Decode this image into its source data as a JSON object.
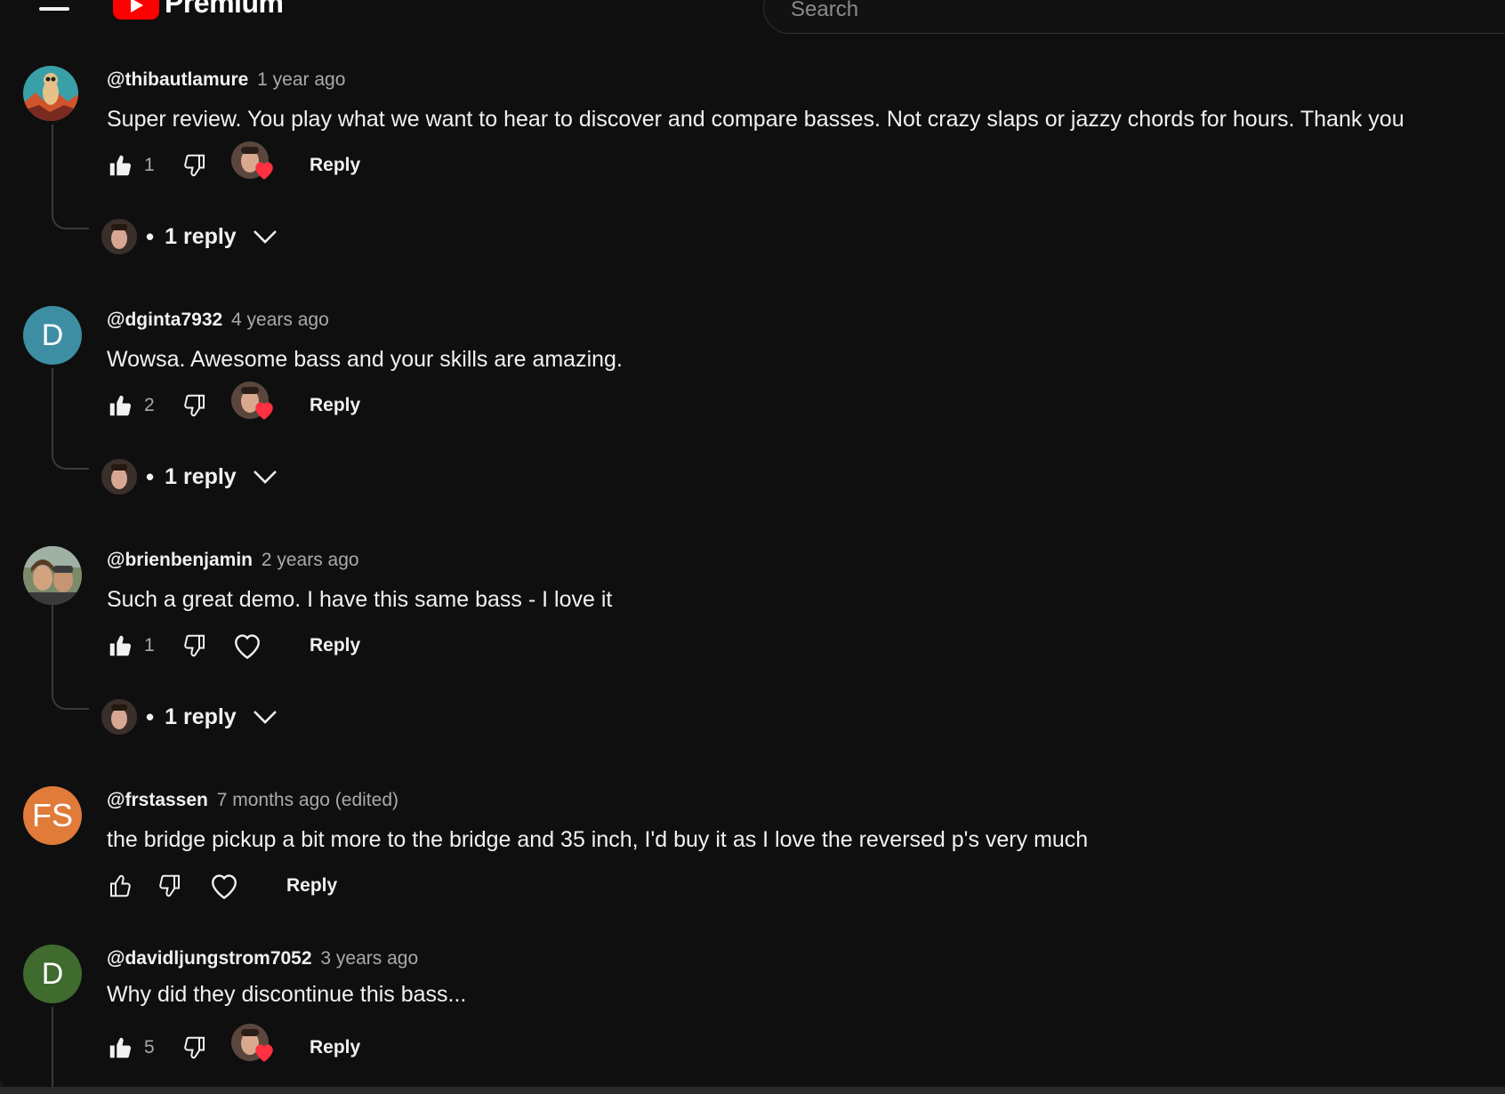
{
  "header": {
    "menu_icon": "hamburger-menu-icon",
    "logo_text": "Premium",
    "search_placeholder": "Search"
  },
  "comments": [
    {
      "handle": "@thibautlamure",
      "time": "1 year ago",
      "text": "Super review. You play what we want to hear to discover and compare basses. Not crazy slaps or jazzy chords for hours. Thank you",
      "likes": "1",
      "hearted_by_creator": true,
      "replies_label": "1 reply",
      "reply_label": "Reply",
      "avatar_color": "#c8884a"
    },
    {
      "handle": "@dginta7932",
      "time": "4 years ago",
      "text": "Wowsa.  Awesome bass and your skills are amazing.",
      "likes": "2",
      "hearted_by_creator": true,
      "replies_label": "1 reply",
      "reply_label": "Reply",
      "avatar_letter": "D",
      "avatar_color": "#3d8ea3"
    },
    {
      "handle": "@brienbenjamin",
      "time": "2 years ago",
      "text": "Such a great demo. I have this same bass - I love it",
      "likes": "1",
      "hearted_by_creator": false,
      "replies_label": "1 reply",
      "reply_label": "Reply",
      "avatar_color": "#6a6f5a"
    },
    {
      "handle": "@frstassen",
      "time": "7 months ago (edited)",
      "text": "the bridge pickup a bit more to the bridge and 35 inch, I'd buy it as I love the reversed p's very much",
      "likes": "",
      "hearted_by_creator": false,
      "reply_label": "Reply",
      "avatar_letter": "FS",
      "avatar_color": "#e07b39"
    },
    {
      "handle": "@davidljungstrom7052",
      "time": "3 years ago",
      "text": "Why did they discontinue this bass...",
      "likes": "5",
      "hearted_by_creator": true,
      "reply_label": "Reply",
      "avatar_letter": "D",
      "avatar_color": "#3f6b2e"
    }
  ],
  "colors": {
    "background": "#0f0f0f",
    "heart_red": "#ff3040",
    "brand_red": "#ff0000"
  }
}
